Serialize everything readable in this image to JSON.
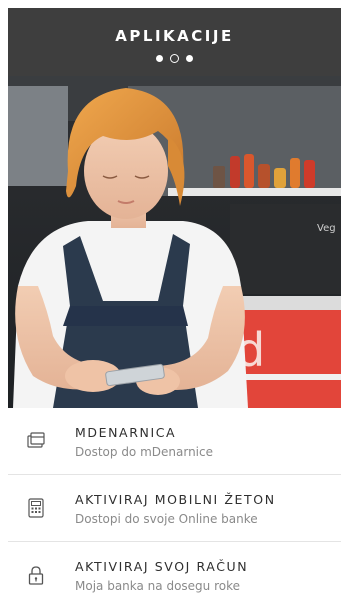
{
  "header": {
    "title": "APLIKACIJE",
    "pager": {
      "count": 3,
      "active_index": 1
    }
  },
  "hero": {
    "image": "woman-using-smartphone-photo",
    "storefront_letter": "d",
    "chalkboard_text": "Veg"
  },
  "menu": {
    "items": [
      {
        "title": "MDENARNICA",
        "subtitle": "Dostop do mDenarnice",
        "icon": "wallet-icon"
      },
      {
        "title": "AKTIVIRAJ MOBILNI ŽETON",
        "subtitle": "Dostopi do svoje Online banke",
        "icon": "calculator-icon"
      },
      {
        "title": "AKTIVIRAJ SVOJ RAČUN",
        "subtitle": "Moja banka na dosegu roke",
        "icon": "lock-icon"
      }
    ]
  },
  "colors": {
    "header_bg": "#3e3e3e",
    "accent_red": "#e2453a",
    "title_text": "#2f2f2f",
    "subtitle_text": "#8a8a8a"
  }
}
